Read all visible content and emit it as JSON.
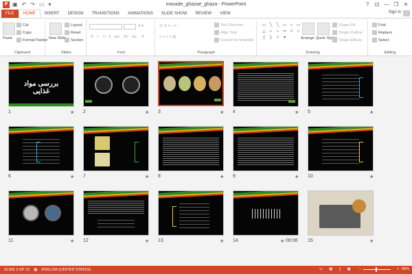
{
  "titlebar": {
    "app_letter": "P",
    "title": "mavade_ghazae_ghaza - PowerPoint",
    "help": "?",
    "minimize": "—",
    "restore": "❐",
    "close": "✕"
  },
  "tabs": [
    {
      "label": "FILE"
    },
    {
      "label": "HOME"
    },
    {
      "label": "INSERT"
    },
    {
      "label": "DESIGN"
    },
    {
      "label": "TRANSITIONS"
    },
    {
      "label": "ANIMATIONS"
    },
    {
      "label": "SLIDE SHOW"
    },
    {
      "label": "REVIEW"
    },
    {
      "label": "VIEW"
    }
  ],
  "signin": "Sign in",
  "ribbon": {
    "clipboard": {
      "paste": "Paste",
      "cut": "Cut",
      "copy": "Copy",
      "format_painter": "Format Painter",
      "label": "Clipboard"
    },
    "slides": {
      "new_slide": "New Slide",
      "layout": "Layout",
      "reset": "Reset",
      "section": "Section",
      "label": "Slides"
    },
    "font": {
      "label": "Font",
      "bold": "B",
      "italic": "I",
      "underline": "U",
      "strike": "S",
      "shadow": "abc",
      "spacing": "AV",
      "case": "Aa"
    },
    "paragraph": {
      "text_direction": "Text Direction",
      "align_text": "Align Text",
      "convert_smartart": "Convert to SmartArt",
      "label": "Paragraph"
    },
    "drawing": {
      "arrange": "Arrange",
      "quick_styles": "Quick Styles",
      "shape_fill": "Shape Fill",
      "shape_outline": "Shape Outline",
      "shape_effects": "Shape Effects",
      "label": "Drawing"
    },
    "editing": {
      "find": "Find",
      "replace": "Replace",
      "select": "Select",
      "label": "Editing"
    }
  },
  "slides": [
    {
      "num": "1",
      "title": "بررسی مواد غذایی"
    },
    {
      "num": "2"
    },
    {
      "num": "3"
    },
    {
      "num": "4"
    },
    {
      "num": "5"
    },
    {
      "num": "6"
    },
    {
      "num": "7"
    },
    {
      "num": "8"
    },
    {
      "num": "9"
    },
    {
      "num": "10"
    },
    {
      "num": "11"
    },
    {
      "num": "12"
    },
    {
      "num": "13"
    },
    {
      "num": "14",
      "time": "00:06"
    },
    {
      "num": "15"
    }
  ],
  "star": "★",
  "status": {
    "slide_info": "SLIDE 3 OF 15",
    "language": "ENGLISH (UNITED STATES)",
    "zoom": "66%",
    "minus": "–",
    "plus": "+"
  },
  "colors": {
    "accent": "#d24726",
    "slide_bg": "#050505",
    "swoosh_green": "#2e8b22",
    "swoosh_yellow": "#e8b018"
  }
}
